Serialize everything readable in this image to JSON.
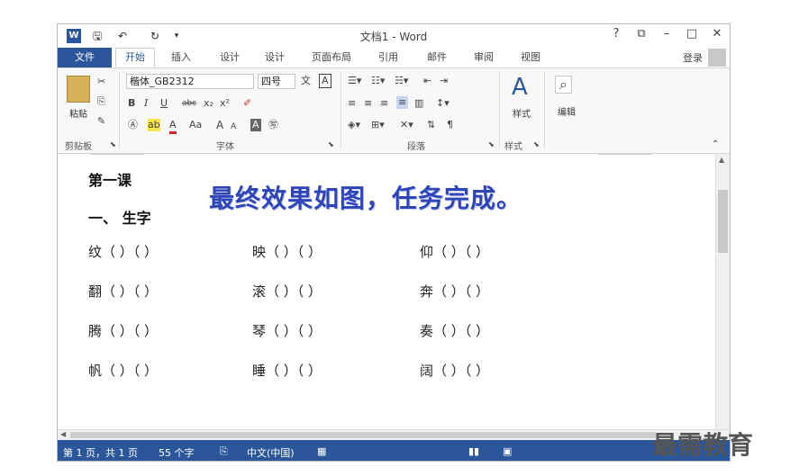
{
  "window": {
    "title": "文档1 - Word",
    "controls": [
      "?",
      "⧉",
      "–",
      "□",
      "✕"
    ]
  },
  "quick_access": {
    "save": "🖫",
    "undo": "↶",
    "redo": "↻",
    "customize": "▾"
  },
  "tabs": {
    "file": "文件",
    "items": [
      "开始",
      "插入",
      "设计",
      "设计",
      "页面布局",
      "引用",
      "邮件",
      "审阅",
      "视图"
    ],
    "login": "登录"
  },
  "ribbon": {
    "clipboard": {
      "paste": "粘贴",
      "label": "剪贴板"
    },
    "font": {
      "name": "楷体_GB2312",
      "size": "四号",
      "label": "字体",
      "bold": "B",
      "italic": "I",
      "underline": "U",
      "strike": "abc",
      "sub": "x₂",
      "sup": "x²",
      "grow": "A",
      "shrink": "A",
      "case": "Aa",
      "clear": "A"
    },
    "paragraph": {
      "label": "段落"
    },
    "styles": {
      "label": "样式",
      "button": "样式"
    },
    "editing": {
      "button": "编辑"
    }
  },
  "document": {
    "lesson_title": "第一课",
    "section": "一、  生字",
    "banner": "最终效果如图，任务完成。",
    "rows": [
      [
        "纹（    ）（    ）",
        "映（    ）（    ）",
        "仰（    ）（    ）"
      ],
      [
        "翻（    ）（    ）",
        "滚（    ）（    ）",
        "奔（    ）（    ）"
      ],
      [
        "腾（    ）（    ）",
        "琴（    ）（    ）",
        "奏（    ）（    ）"
      ],
      [
        "帆（    ）（    ）",
        "睡（    ）（    ）",
        "阔（    ）（    ）"
      ]
    ]
  },
  "status": {
    "pages": "第 1 页，共 1 页",
    "words": "55 个字",
    "language": "中文(中国)"
  },
  "watermark": "最需教育",
  "colors": {
    "accent": "#2b579a",
    "banner": "#2e45b8"
  }
}
